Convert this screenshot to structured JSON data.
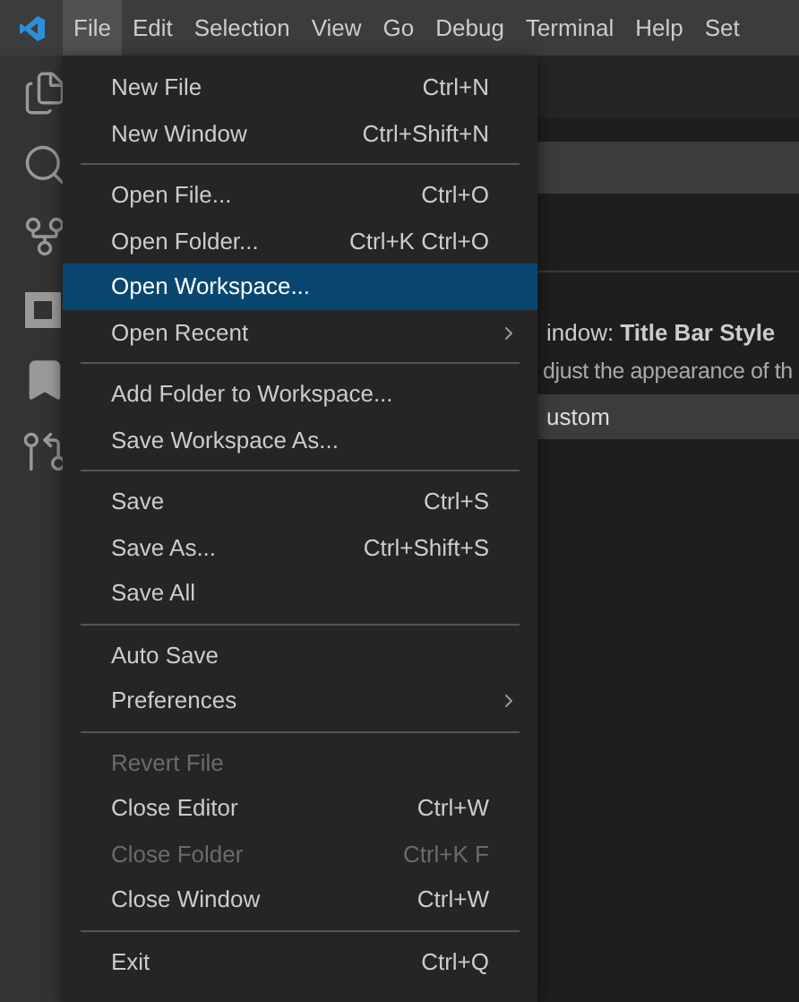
{
  "menubar": [
    {
      "label": "File",
      "selected": true
    },
    {
      "label": "Edit",
      "selected": false
    },
    {
      "label": "Selection",
      "selected": false
    },
    {
      "label": "View",
      "selected": false
    },
    {
      "label": "Go",
      "selected": false
    },
    {
      "label": "Debug",
      "selected": false
    },
    {
      "label": "Terminal",
      "selected": false
    },
    {
      "label": "Help",
      "selected": false
    },
    {
      "label": "Set",
      "selected": false
    }
  ],
  "file_menu": [
    {
      "kind": "item",
      "label": "New File",
      "shortcut": "Ctrl+N",
      "selected": false,
      "disabled": false
    },
    {
      "kind": "item",
      "label": "New Window",
      "shortcut": "Ctrl+Shift+N",
      "selected": false,
      "disabled": false
    },
    {
      "kind": "separator"
    },
    {
      "kind": "item",
      "label": "Open File...",
      "shortcut": "Ctrl+O",
      "selected": false,
      "disabled": false
    },
    {
      "kind": "item",
      "label": "Open Folder...",
      "shortcut": "Ctrl+K Ctrl+O",
      "selected": false,
      "disabled": false
    },
    {
      "kind": "item",
      "label": "Open Workspace...",
      "selected": true,
      "disabled": false
    },
    {
      "kind": "submenu",
      "label": "Open Recent",
      "selected": false,
      "disabled": false
    },
    {
      "kind": "separator"
    },
    {
      "kind": "item",
      "label": "Add Folder to Workspace...",
      "selected": false,
      "disabled": false
    },
    {
      "kind": "item",
      "label": "Save Workspace As...",
      "selected": false,
      "disabled": false
    },
    {
      "kind": "separator"
    },
    {
      "kind": "item",
      "label": "Save",
      "shortcut": "Ctrl+S",
      "selected": false,
      "disabled": false
    },
    {
      "kind": "item",
      "label": "Save As...",
      "shortcut": "Ctrl+Shift+S",
      "selected": false,
      "disabled": false
    },
    {
      "kind": "item",
      "label": "Save All",
      "selected": false,
      "disabled": false
    },
    {
      "kind": "separator"
    },
    {
      "kind": "item",
      "label": "Auto Save",
      "selected": false,
      "disabled": false
    },
    {
      "kind": "submenu",
      "label": "Preferences",
      "selected": false,
      "disabled": false
    },
    {
      "kind": "separator"
    },
    {
      "kind": "item",
      "label": "Revert File",
      "selected": false,
      "disabled": true
    },
    {
      "kind": "item",
      "label": "Close Editor",
      "shortcut": "Ctrl+W",
      "selected": false,
      "disabled": false
    },
    {
      "kind": "item",
      "label": "Close Folder",
      "shortcut": "Ctrl+K F",
      "selected": false,
      "disabled": true
    },
    {
      "kind": "item",
      "label": "Close Window",
      "shortcut": "Ctrl+W",
      "selected": false,
      "disabled": false
    },
    {
      "kind": "separator"
    },
    {
      "kind": "item",
      "label": "Exit",
      "shortcut": "Ctrl+Q",
      "selected": false,
      "disabled": false
    }
  ],
  "settings": {
    "setting_title": "indow: **Title Bar Style**",
    "description": "djust the appearance of th",
    "dropdown_value": "ustom"
  }
}
